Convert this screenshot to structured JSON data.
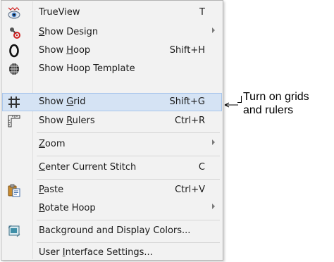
{
  "menu": {
    "items": [
      {
        "label": "TrueView",
        "mnemonic": "",
        "shortcut": "T",
        "icon": "trueview-eye-icon"
      },
      {
        "label_pre": "",
        "mnemonic": "S",
        "label_post": "how Design",
        "shortcut": "",
        "submenu": true,
        "icon": "show-design-icon"
      },
      {
        "label_pre": "Show ",
        "mnemonic": "H",
        "label_post": "oop",
        "shortcut": "Shift+H",
        "icon": "hoop-icon"
      },
      {
        "label": "Show Hoop Template",
        "shortcut": "",
        "icon": "hoop-template-icon"
      },
      {
        "label_pre": "Show ",
        "mnemonic": "G",
        "label_post": "rid",
        "shortcut": "Shift+G",
        "icon": "grid-icon",
        "highlighted": true
      },
      {
        "label_pre": "Show ",
        "mnemonic": "R",
        "label_post": "ulers",
        "shortcut": "Ctrl+R",
        "icon": "rulers-icon"
      },
      {
        "label_pre": "",
        "mnemonic": "Z",
        "label_post": "oom",
        "shortcut": "",
        "submenu": true
      },
      {
        "label_pre": "",
        "mnemonic": "C",
        "label_post": "enter Current Stitch",
        "shortcut": "C"
      },
      {
        "label_pre": "",
        "mnemonic": "P",
        "label_post": "aste",
        "shortcut": "Ctrl+V",
        "icon": "paste-icon"
      },
      {
        "label_pre": "",
        "mnemonic": "R",
        "label_post": "otate Hoop",
        "shortcut": "",
        "submenu": true
      },
      {
        "label": "Background and Display Colors...",
        "shortcut": "",
        "icon": "background-colors-icon"
      },
      {
        "label_pre": "User ",
        "mnemonic": "I",
        "label_post": "nterface Settings...",
        "shortcut": ""
      }
    ]
  },
  "callout": {
    "line1": "Turn on grids",
    "line2": "and rulers"
  },
  "colors": {
    "highlight_bg": "#d5e3f4",
    "highlight_border": "#a9c6ec",
    "menu_bg": "#f2f2f2",
    "text": "#1a1a1a"
  }
}
